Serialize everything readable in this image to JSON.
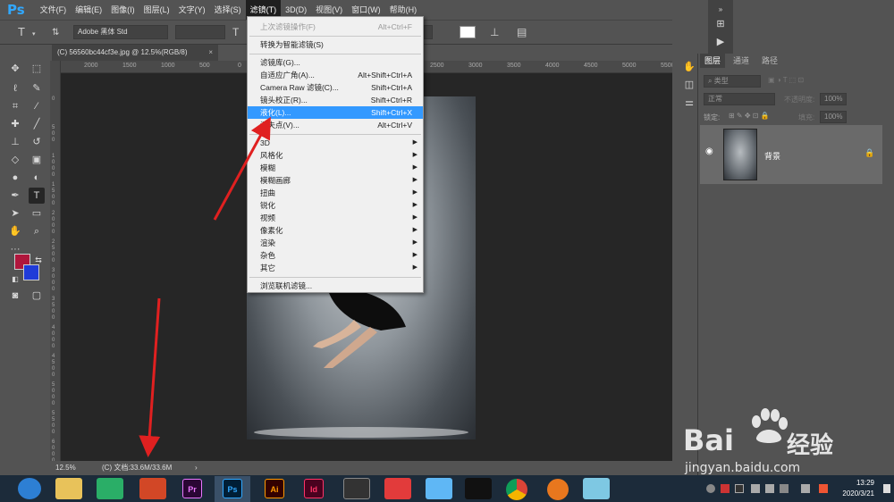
{
  "app": {
    "logo": "Ps"
  },
  "menubar": {
    "items": [
      "文件(F)",
      "编辑(E)",
      "图像(I)",
      "图层(L)",
      "文字(Y)",
      "选择(S)",
      "滤镜(T)",
      "3D(D)",
      "视图(V)",
      "窗口(W)",
      "帮助(H)"
    ],
    "active_index": 6
  },
  "options": {
    "tool_glyph": "T",
    "font_family": "Adobe 黑体 Std",
    "font_style": "",
    "size": "",
    "antialias": "",
    "color_swatch": "#ffffff"
  },
  "document": {
    "tab_title": "(C) 56560bc44cf3e.jpg @ 12.5%(RGB/8)",
    "close_glyph": "×"
  },
  "ruler": {
    "top_ticks": [
      "2000",
      "1500",
      "1000",
      "500",
      "0",
      "500",
      "1000",
      "1500",
      "2000",
      "2500",
      "3000",
      "3500",
      "4000",
      "4500",
      "5000",
      "5500"
    ],
    "left_ticks": [
      "0",
      "5 0 0",
      "1 0 0 0",
      "1 5 0 0",
      "2 0 0 0",
      "2 5 0 0",
      "3 0 0 0",
      "3 5 0 0",
      "4 0 0 0",
      "4 5 0 0",
      "5 0 0 0",
      "5 5 0 0",
      "6 0 0 0"
    ]
  },
  "statusbar": {
    "zoom": "12.5%",
    "doc_info": "(C) 文档:33.6M/33.6M",
    "arrow": "›"
  },
  "filter_menu": {
    "last_filter": {
      "label": "上次滤镜操作(F)",
      "shortcut": "Alt+Ctrl+F"
    },
    "smart": "转换为智能滤镜(S)",
    "group1": [
      {
        "label": "滤镜库(G)...",
        "shortcut": ""
      },
      {
        "label": "自适应广角(A)...",
        "shortcut": "Alt+Shift+Ctrl+A"
      },
      {
        "label": "Camera Raw 滤镜(C)...",
        "shortcut": "Shift+Ctrl+A"
      },
      {
        "label": "镜头校正(R)...",
        "shortcut": "Shift+Ctrl+R"
      },
      {
        "label": "液化(L)...",
        "shortcut": "Shift+Ctrl+X"
      },
      {
        "label": "消失点(V)...",
        "shortcut": "Alt+Ctrl+V"
      }
    ],
    "submenus": [
      "3D",
      "风格化",
      "模糊",
      "模糊画廊",
      "扭曲",
      "锐化",
      "视频",
      "像素化",
      "渲染",
      "杂色",
      "其它"
    ],
    "browse": "浏览联机滤镜..."
  },
  "layers_panel": {
    "tabs": [
      "图层",
      "通道",
      "路径"
    ],
    "search_placeholder": "类型",
    "blend_mode": "正常",
    "opacity_label": "不透明度:",
    "opacity_value": "100%",
    "lock_label": "锁定:",
    "fill_label": "填充:",
    "fill_value": "100%",
    "layer_name": "背景"
  },
  "taskbar": {
    "apps": [
      {
        "name": "Pr",
        "fg": "#ea77ff",
        "bg": "#2a0634"
      },
      {
        "name": "Ps",
        "fg": "#31a8ff",
        "bg": "#001e36"
      },
      {
        "name": "Ai",
        "fg": "#ff9a00",
        "bg": "#330000"
      },
      {
        "name": "Id",
        "fg": "#ff3366",
        "bg": "#49021f"
      }
    ],
    "time": "13:29",
    "date": "2020/3/21"
  },
  "watermark": {
    "brand_left": "Bai",
    "brand_right": "经验",
    "url": "jingyan.baidu.com"
  },
  "colors": {
    "accent_blue": "#3399ff",
    "arrow_red": "#e02020",
    "foreground": "#b0163c",
    "background": "#1f3bd8"
  }
}
